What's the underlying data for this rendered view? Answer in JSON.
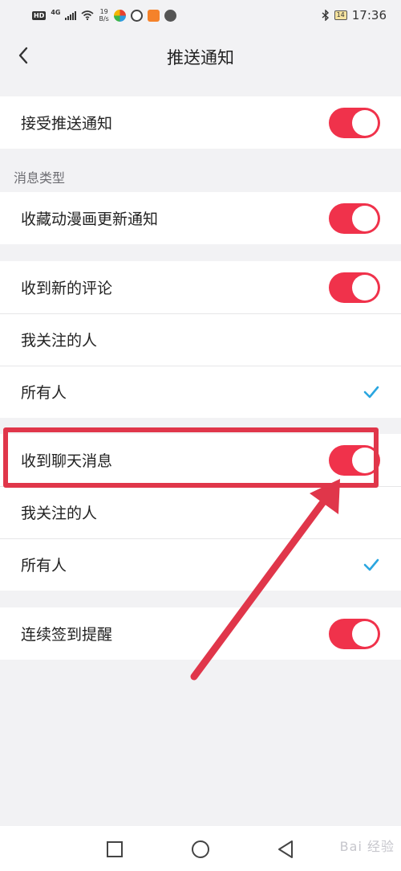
{
  "status_bar": {
    "hd": "HD",
    "network": "4G",
    "speed_value": "19",
    "speed_unit": "B/s",
    "battery": "14",
    "time": "17:36"
  },
  "header": {
    "title": "推送通知"
  },
  "settings": {
    "accept_push": {
      "label": "接受推送通知",
      "enabled": true
    },
    "section_message_type": "消息类型",
    "favorite_update": {
      "label": "收藏动漫画更新通知",
      "enabled": true
    },
    "new_comment": {
      "label": "收到新的评论",
      "enabled": true,
      "options": [
        {
          "label": "我关注的人",
          "selected": false
        },
        {
          "label": "所有人",
          "selected": true
        }
      ]
    },
    "chat_message": {
      "label": "收到聊天消息",
      "enabled": true,
      "options": [
        {
          "label": "我关注的人",
          "selected": false
        },
        {
          "label": "所有人",
          "selected": true
        }
      ]
    },
    "checkin_reminder": {
      "label": "连续签到提醒",
      "enabled": true
    }
  },
  "watermark": "Bai 经验",
  "colors": {
    "toggle_on": "#f0324b",
    "check": "#2aa6e0",
    "annotation": "#e0364a",
    "background": "#f2f2f4"
  },
  "icons": {
    "back": "chevron-left-icon",
    "check": "checkmark-icon",
    "nav_recent": "square-icon",
    "nav_home": "circle-icon",
    "nav_back": "triangle-back-icon"
  }
}
